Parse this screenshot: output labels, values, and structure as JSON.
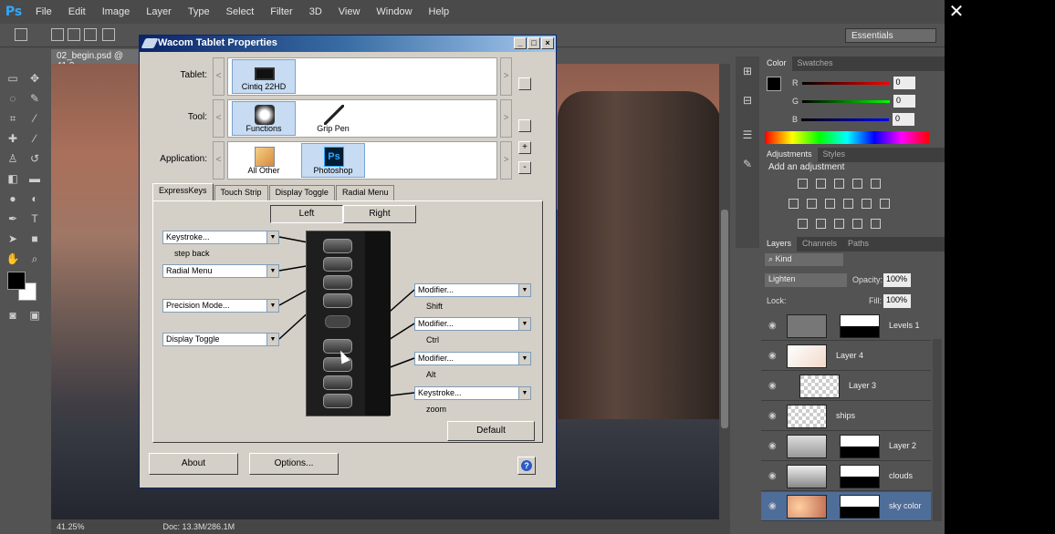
{
  "photoshop": {
    "logo": "Ps",
    "menu": [
      "File",
      "Edit",
      "Image",
      "Layer",
      "Type",
      "Select",
      "Filter",
      "3D",
      "View",
      "Window",
      "Help"
    ],
    "workspace": "Essentials",
    "document_tab": "02_begin.psd @ 41.3",
    "status_zoom": "41.25%",
    "status_doc": "Doc: 13.3M/286.1M"
  },
  "color_panel": {
    "tabs": [
      "Color",
      "Swatches"
    ],
    "rows": [
      {
        "label": "R",
        "value": "0",
        "color": "#ff2020"
      },
      {
        "label": "G",
        "value": "0",
        "color": "#20c020"
      },
      {
        "label": "B",
        "value": "0",
        "color": "#2030ff"
      }
    ]
  },
  "adjustments_panel": {
    "tabs": [
      "Adjustments",
      "Styles"
    ],
    "title": "Add an adjustment"
  },
  "layers_panel": {
    "tabs": [
      "Layers",
      "Channels",
      "Paths"
    ],
    "kind_filter": "Kind",
    "blend_mode": "Lighten",
    "opacity_label": "Opacity:",
    "opacity": "100%",
    "lock_label": "Lock:",
    "fill_label": "Fill:",
    "fill": "100%",
    "layers": [
      {
        "name": "Levels 1",
        "mask": true,
        "selected": false
      },
      {
        "name": "Layer 4",
        "mask": false,
        "selected": false
      },
      {
        "name": "Layer 3",
        "mask": false,
        "selected": false
      },
      {
        "name": "ships",
        "mask": false,
        "selected": false
      },
      {
        "name": "Layer 2",
        "mask": true,
        "selected": false
      },
      {
        "name": "clouds",
        "mask": true,
        "selected": false
      },
      {
        "name": "sky color",
        "mask": true,
        "selected": true
      }
    ]
  },
  "dialog": {
    "title": "Wacom Tablet Properties",
    "tablet_label": "Tablet:",
    "tool_label": "Tool:",
    "application_label": "Application:",
    "tablet_items": [
      {
        "label": "Cintiq 22HD",
        "selected": true
      }
    ],
    "tool_items": [
      {
        "label": "Functions",
        "selected": true
      },
      {
        "label": "Grip Pen",
        "selected": false
      }
    ],
    "application_items": [
      {
        "label": "All Other",
        "selected": false
      },
      {
        "label": "Photoshop",
        "selected": true
      }
    ],
    "app_icon_text": "Ps",
    "tabs": [
      "ExpressKeys",
      "Touch Strip",
      "Display Toggle",
      "Radial Menu"
    ],
    "side_buttons": [
      "Left",
      "Right"
    ],
    "left_assignments": [
      {
        "value": "Keystroke...",
        "sublabel": "step back"
      },
      {
        "value": "Radial Menu",
        "sublabel": ""
      },
      {
        "value": "Precision Mode...",
        "sublabel": ""
      },
      {
        "value": "Display Toggle",
        "sublabel": ""
      }
    ],
    "right_assignments": [
      {
        "value": "Modifier...",
        "sublabel": "Shift"
      },
      {
        "value": "Modifier...",
        "sublabel": "Ctrl"
      },
      {
        "value": "Modifier...",
        "sublabel": "Alt"
      },
      {
        "value": "Keystroke...",
        "sublabel": "zoom"
      }
    ],
    "default_button": "Default",
    "about_button": "About",
    "options_button": "Options...",
    "help_glyph": "?",
    "arrow_left": "<",
    "arrow_right": ">",
    "plus": "+",
    "minus": "-"
  },
  "icons": {
    "close": "close-icon",
    "help": "help-icon",
    "eye": "eye-icon"
  }
}
